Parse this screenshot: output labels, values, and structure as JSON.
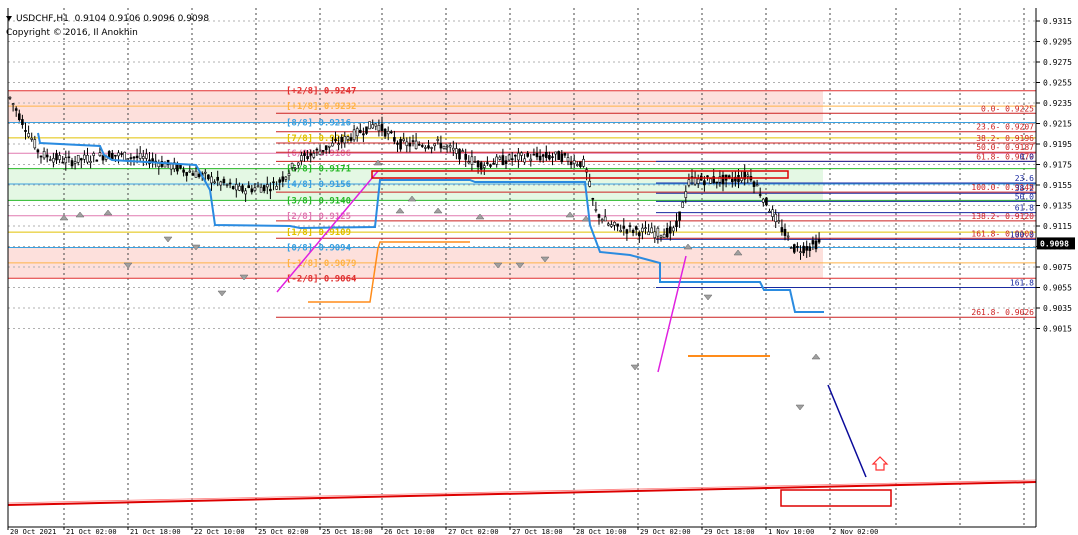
{
  "header": {
    "symbol": "USDCHF,H1",
    "ohlc": "0.9104 0.9106 0.9096 0.9098",
    "copyright": "Copyright © 2016, Il Anokhin"
  },
  "price_axis": {
    "ticks": [
      "0.9315",
      "0.9295",
      "0.9275",
      "0.9255",
      "0.9235",
      "0.9215",
      "0.9195",
      "0.9175",
      "0.9155",
      "0.9135",
      "0.9115",
      "0.9095",
      "0.9075",
      "0.9055",
      "0.9035",
      "0.9015"
    ],
    "current_price": "0.9098"
  },
  "time_axis": {
    "labels": [
      "20 Oct 2021",
      "21 Oct 02:00",
      "21 Oct 18:00",
      "22 Oct 10:00",
      "25 Oct 02:00",
      "25 Oct 18:00",
      "26 Oct 10:00",
      "27 Oct 02:00",
      "27 Oct 18:00",
      "28 Oct 10:00",
      "29 Oct 02:00",
      "29 Oct 18:00",
      "1 Nov 10:00",
      "2 Nov 02:00"
    ]
  },
  "murrey_levels": [
    {
      "label": "[+2/8]",
      "value": "0.9247",
      "price": 0.9247,
      "color": "#e03030"
    },
    {
      "label": "[+1/8]",
      "value": "0.9232",
      "price": 0.9232,
      "color": "#ffb347"
    },
    {
      "label": "[8/8]",
      "value": "0.9216",
      "price": 0.9216,
      "color": "#3aa0e0"
    },
    {
      "label": "[7/8]",
      "value": "0.9201",
      "price": 0.9201,
      "color": "#e0c000"
    },
    {
      "label": "[6/8]",
      "value": "0.9186",
      "price": 0.9186,
      "color": "#e07ab0"
    },
    {
      "label": "[5/8]",
      "value": "0.9171",
      "price": 0.9171,
      "color": "#28b828"
    },
    {
      "label": "[4/8]",
      "value": "0.9156",
      "price": 0.9156,
      "color": "#3aa0e0"
    },
    {
      "label": "[3/8]",
      "value": "0.9140",
      "price": 0.914,
      "color": "#28b828"
    },
    {
      "label": "[2/8]",
      "value": "0.9125",
      "price": 0.9125,
      "color": "#e07ab0"
    },
    {
      "label": "[1/8]",
      "value": "0.9109",
      "price": 0.9109,
      "color": "#e0c000"
    },
    {
      "label": "[0/8]",
      "value": "0.9094",
      "price": 0.9094,
      "color": "#3aa0e0"
    },
    {
      "label": "[-1/8]",
      "value": "0.9079",
      "price": 0.9079,
      "color": "#ffb347"
    },
    {
      "label": "[-2/8]",
      "value": "0.9064",
      "price": 0.9064,
      "color": "#e03030"
    }
  ],
  "fib_red": [
    {
      "label": "0.0- 0.9225",
      "price": 0.9225
    },
    {
      "label": "23.6- 0.9207",
      "price": 0.9207
    },
    {
      "label": "38.2- 0.9196",
      "price": 0.9196
    },
    {
      "label": "50.0- 0.9187",
      "price": 0.9187
    },
    {
      "label": "61.8- 0.9179",
      "price": 0.9178
    },
    {
      "label": "100.0- 0.9148",
      "price": 0.9148
    },
    {
      "label": "138.2- 0.9120",
      "price": 0.912
    },
    {
      "label": "161.8- 0.9103",
      "price": 0.9103
    },
    {
      "label": "261.8- 0.9026",
      "price": 0.9026
    }
  ],
  "fib_blue": [
    {
      "label": "0.0",
      "price": 0.9178
    },
    {
      "label": "23.6",
      "price": 0.9157
    },
    {
      "label": "38.2",
      "price": 0.9147
    },
    {
      "label": "50.0",
      "price": 0.9139
    },
    {
      "label": "61.8",
      "price": 0.9128
    },
    {
      "label": "100.0",
      "price": 0.9102
    },
    {
      "label": "161.8",
      "price": 0.9055
    }
  ],
  "colors": {
    "zone_top": "#fde0dc",
    "zone_mid": "#e4f8e4",
    "zone_bottom": "#fde0dc",
    "candle": "#000000",
    "trail": "#2a8be0",
    "trail_orange": "#ff8c1a",
    "projection": "#0a0a9a",
    "impulse": "#e020e0",
    "channel": "#dd0000"
  },
  "icons": {
    "up_arrow": "up-arrow-icon",
    "fractal": "fractal-marker-icon"
  }
}
